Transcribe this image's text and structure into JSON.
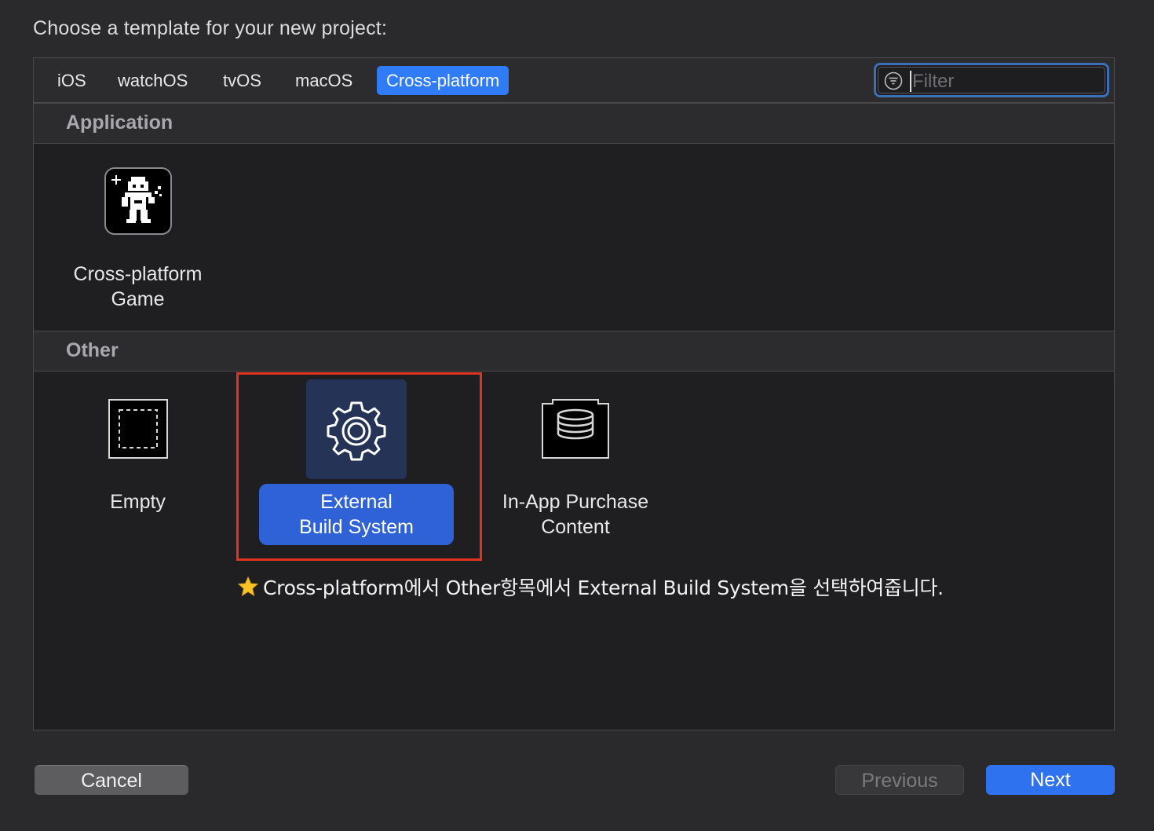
{
  "dialog": {
    "title": "Choose a template for your new project:"
  },
  "tabs": [
    {
      "label": "iOS"
    },
    {
      "label": "watchOS"
    },
    {
      "label": "tvOS"
    },
    {
      "label": "macOS"
    },
    {
      "label": "Cross-platform",
      "active": true
    }
  ],
  "filter": {
    "placeholder": "Filter",
    "icon": "filter-icon"
  },
  "sections": [
    {
      "header": "Application",
      "templates": [
        {
          "label": "Cross-platform\nGame",
          "icon": "game-sprite-icon"
        }
      ]
    },
    {
      "header": "Other",
      "templates": [
        {
          "label": "Empty",
          "icon": "empty-template-icon"
        },
        {
          "label": "External\nBuild System",
          "icon": "gear-icon",
          "selected": true
        },
        {
          "label": "In-App Purchase\nContent",
          "icon": "in-app-purchase-icon"
        }
      ]
    }
  ],
  "annotation": {
    "text": "Cross-platform에서 Other항목에서 External Build System을 선택하여줍니다.",
    "icon": "star-icon"
  },
  "buttons": {
    "cancel": "Cancel",
    "previous": "Previous",
    "next": "Next"
  },
  "colors": {
    "accent": "#2f7cf6",
    "selection": "#2f62d6",
    "highlight_border": "#e0341f"
  }
}
